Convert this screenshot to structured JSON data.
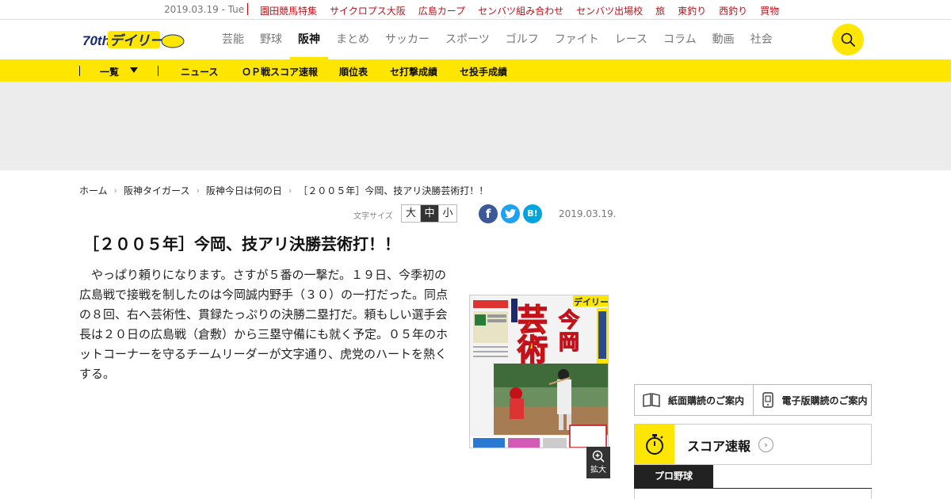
{
  "topbar": {
    "date": "2019.03.19 - Tue",
    "links": [
      "園田競馬特集",
      "サイクロプス大阪",
      "広島カープ",
      "センバツ組み合わせ",
      "センバツ出場校",
      "旅",
      "東釣り",
      "西釣り",
      "買物"
    ]
  },
  "header": {
    "logo_text": "デイリー",
    "logo_anniv": "70th",
    "nav": [
      "芸能",
      "野球",
      "阪神",
      "まとめ",
      "サッカー",
      "スポーツ",
      "ゴルフ",
      "ファイト",
      "レース",
      "コラム",
      "動画",
      "社会"
    ],
    "active_nav": "阪神"
  },
  "subnav": {
    "items": [
      "一覧",
      "ニュース",
      "ＯＰ戦スコア速報",
      "順位表",
      "セ打撃成績",
      "セ投手成績"
    ]
  },
  "breadcrumb": [
    "ホーム",
    "阪神タイガース",
    "阪神今日は何の日",
    "［２００５年］今岡、技アリ決勝芸術打！！"
  ],
  "toolbar": {
    "font_size_label": "文字サイズ",
    "sizes": [
      "大",
      "中",
      "小"
    ],
    "active_size": "中",
    "share": {
      "fb": "f",
      "tw": "t",
      "hb": "B!"
    },
    "date": "2019.03.19."
  },
  "article": {
    "title": "［２００５年］今岡、技アリ決勝芸術打！！",
    "body": "やっぱり頼りになります。さすが５番の一撃だ。１９日、今季初の広島戦で接戦を制したのは今岡誠内野手（３０）の一打だった。同点の８回、右へ芸術性、貫録たっぷりの決勝二塁打だ。頼もしい選手会長は２０日の広島戦（倉敷）から三塁守備にも就く予定。０５年のホットコーナーを守るチームリーダーが文字通り、虎党のハートを熱くする。",
    "image": {
      "masthead": "デイリー",
      "headline_big_1": "芸",
      "headline_big_2": "術",
      "headline_name_1": "今",
      "headline_name_2": "岡"
    },
    "zoom_label": "拡大"
  },
  "sidebar": {
    "paper_sub": "紙面購読のご案内",
    "digital_sub": "電子版購読のご案内",
    "score_title": "スコア速報",
    "score_tab": "プロ野球"
  },
  "colors": {
    "brand_yellow": "#ffe600",
    "link_red": "#c41019",
    "ad_gray": "#ececec"
  }
}
